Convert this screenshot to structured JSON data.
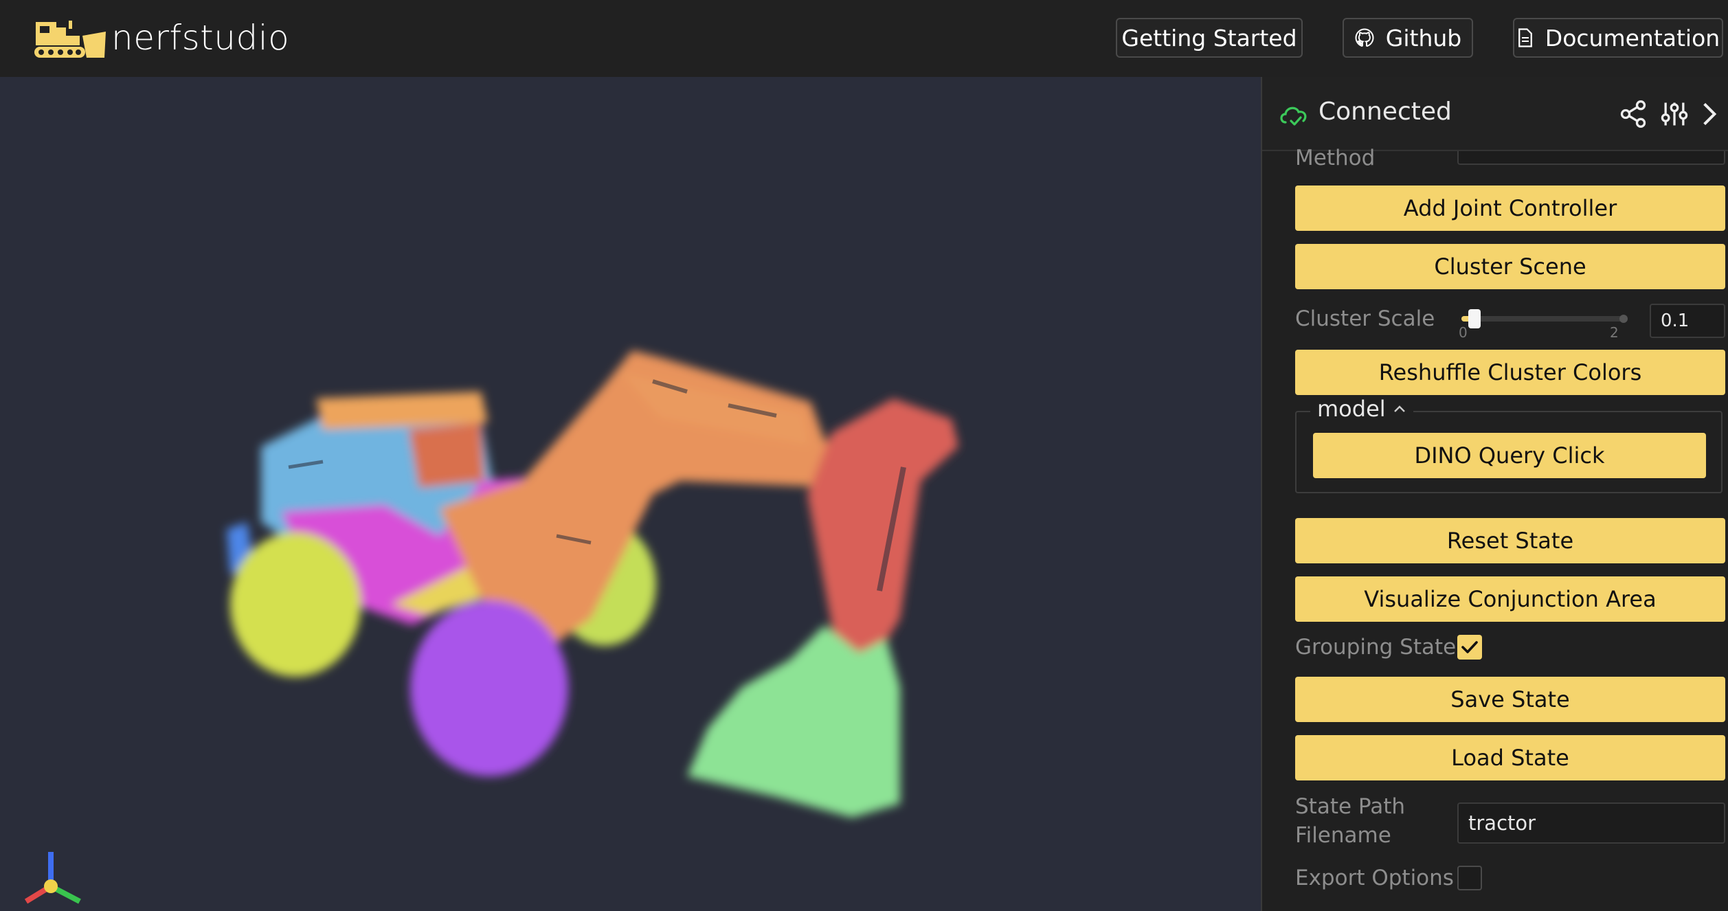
{
  "header": {
    "logo_text": "nerfstudio",
    "nav": [
      {
        "label": "Getting Started"
      },
      {
        "label": "Github",
        "icon": "github-icon"
      },
      {
        "label": "Documentation",
        "icon": "document-icon"
      }
    ]
  },
  "panel": {
    "status": "Connected",
    "method_label": "Method",
    "buttons": {
      "add_joint": "Add Joint Controller",
      "cluster_scene": "Cluster Scene",
      "reshuffle": "Reshuffle Cluster Colors",
      "dino": "DINO Query Click",
      "reset": "Reset State",
      "visualize": "Visualize Conjunction Area",
      "save": "Save State",
      "load": "Load State"
    },
    "cluster_scale": {
      "label": "Cluster Scale",
      "min": "0",
      "max": "2",
      "value": "0.1",
      "fraction": 0.05
    },
    "model_folder": "model",
    "grouping_state": {
      "label": "Grouping State",
      "checked": true
    },
    "state_path": {
      "label_line1": "State Path",
      "label_line2": "Filename",
      "value": "tractor"
    },
    "export_options": {
      "label": "Export Options",
      "checked": false
    }
  },
  "colors": {
    "accent_button": "#f5d46d",
    "connected_icon": "#3cc95a",
    "viewport_bg": "#2a2d3a",
    "topbar_bg": "#212121"
  }
}
